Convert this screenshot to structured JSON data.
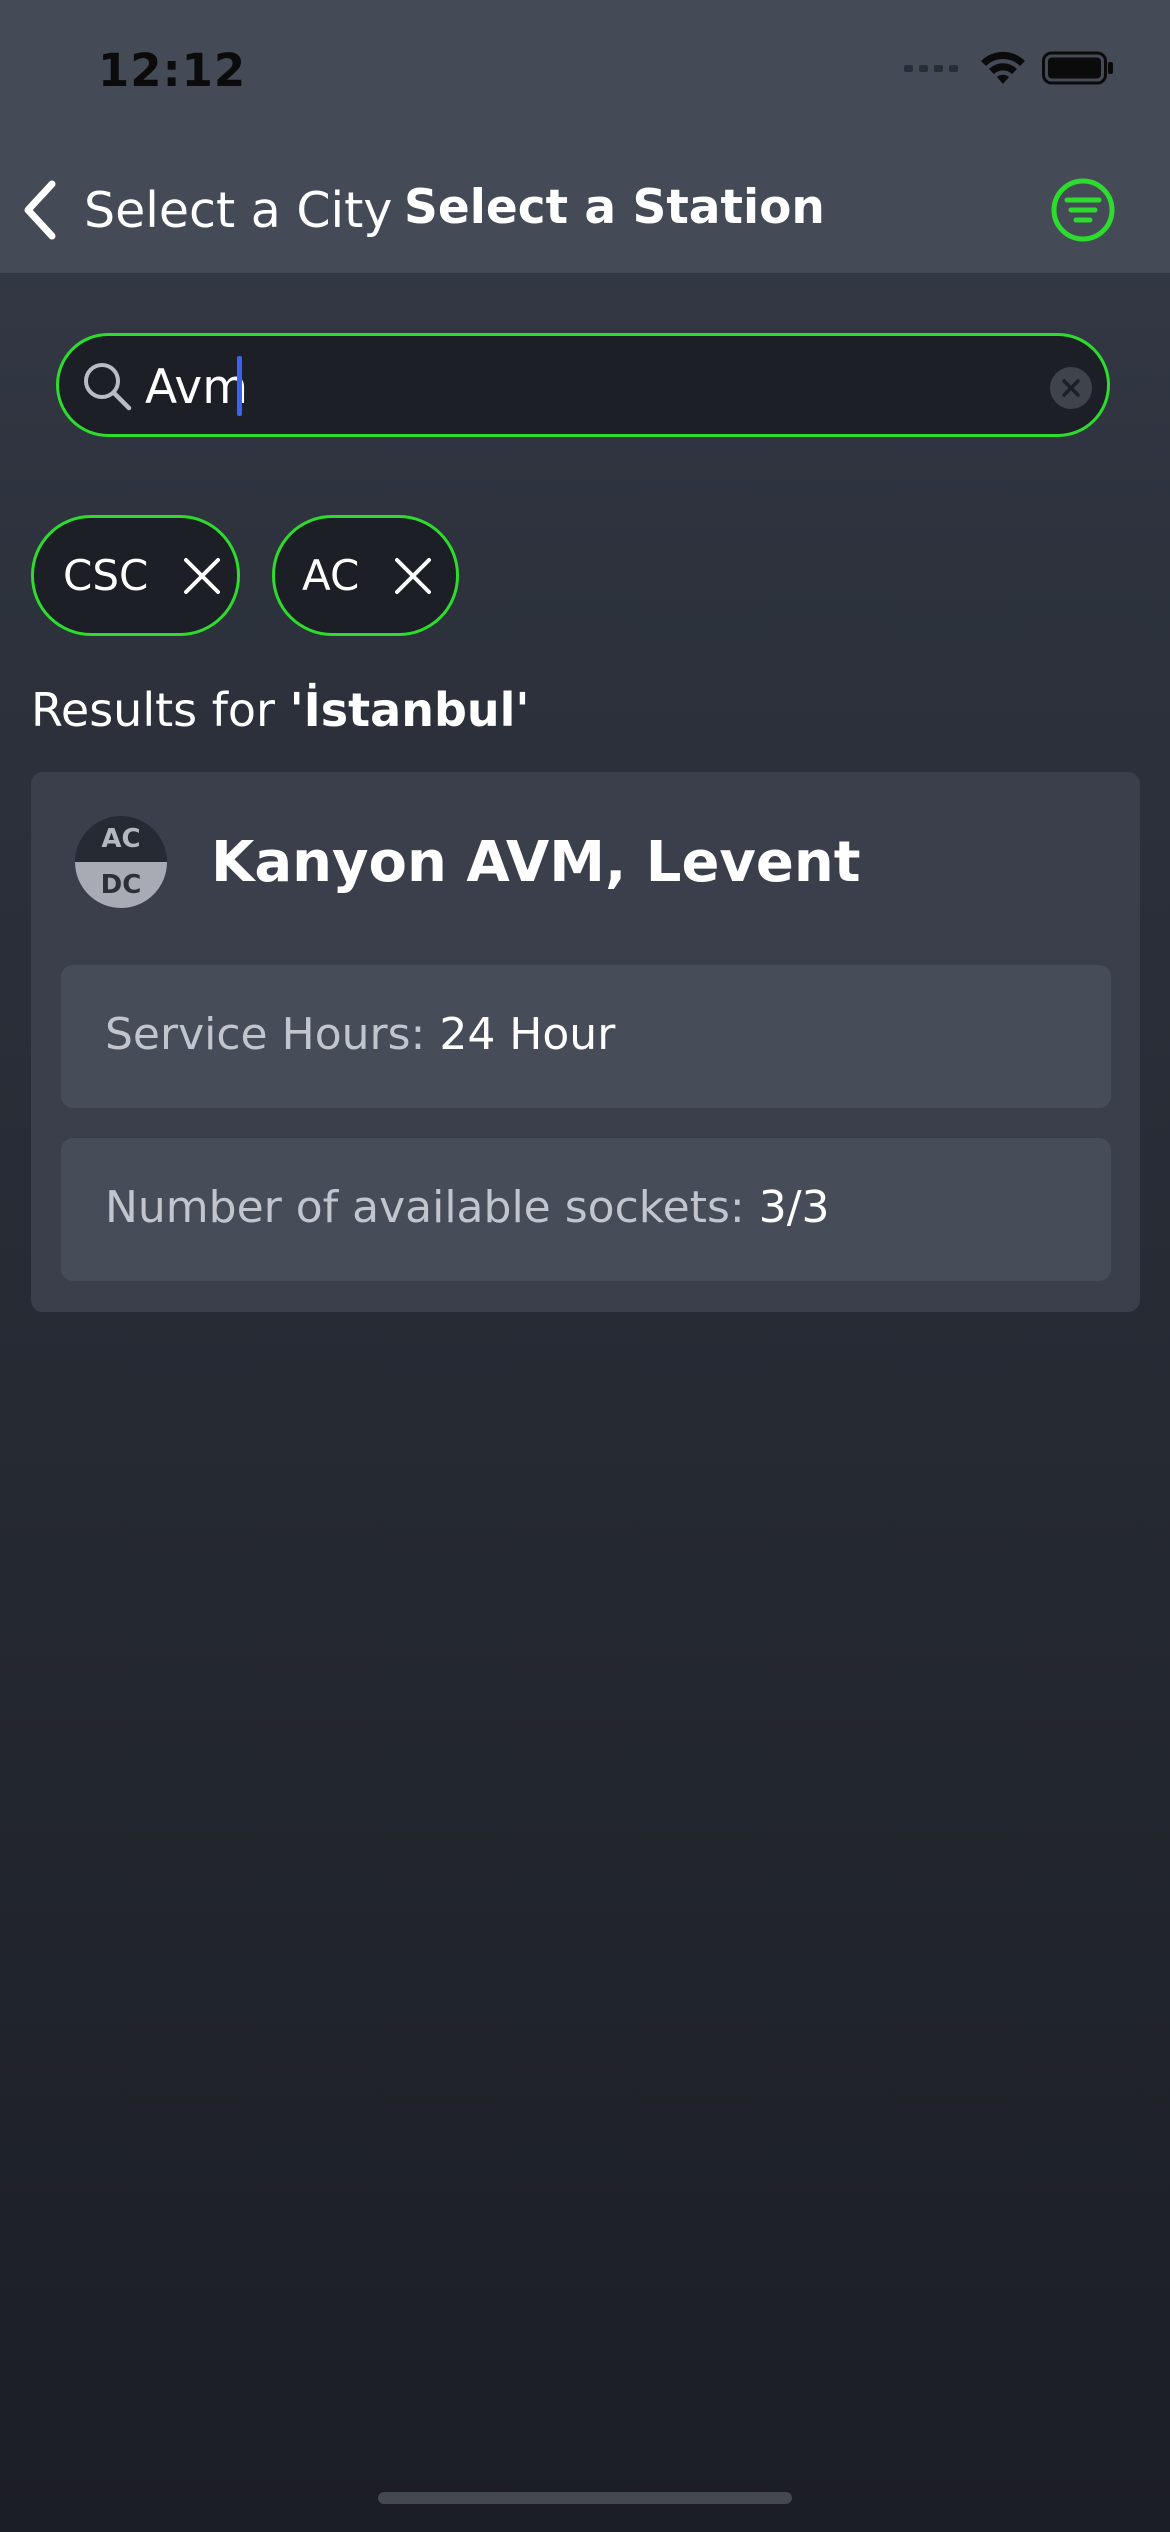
{
  "status_bar": {
    "time": "12:12"
  },
  "nav": {
    "back_label": "Select a City",
    "title": "Select a Station",
    "filter_icon": "filter-icon"
  },
  "search": {
    "value": "Avm",
    "placeholder": ""
  },
  "chips": [
    {
      "label": "CSC"
    },
    {
      "label": "AC"
    }
  ],
  "results": {
    "prefix": "Results for ",
    "city": "'İstanbul'"
  },
  "station": {
    "badge_top": "AC",
    "badge_bottom": "DC",
    "name": "Kanyon AVM, Levent",
    "service_hours_label": "Service Hours: ",
    "service_hours_value": "24 Hour",
    "sockets_label": "Number of available sockets: ",
    "sockets_value": "3/3"
  },
  "colors": {
    "accent": "#2ddc2d",
    "nav_background": "#444a56",
    "card_background": "#3a3f4b",
    "cursor": "#3a63f5"
  }
}
